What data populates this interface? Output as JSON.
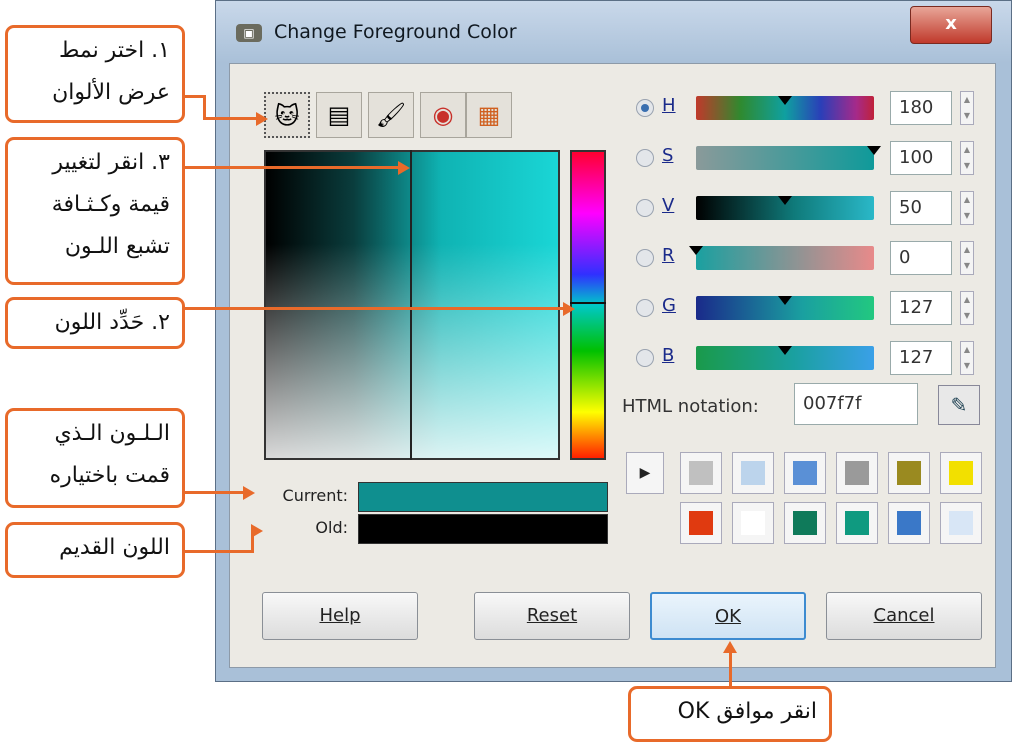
{
  "window": {
    "title": "Change Foreground Color",
    "close_label": "x"
  },
  "tabs": [
    {
      "name": "gimp-selector",
      "icon": "gimp-icon",
      "glyph": "🐱"
    },
    {
      "name": "cmyk-selector",
      "icon": "sliders-icon",
      "glyph": "▤"
    },
    {
      "name": "watercolor-selector",
      "icon": "brush-icon",
      "glyph": "🖌"
    },
    {
      "name": "wheel-selector",
      "icon": "color-wheel-icon",
      "glyph": "◉"
    },
    {
      "name": "palette-selector",
      "icon": "palette-icon",
      "glyph": "▦"
    }
  ],
  "swatches": {
    "current_label": "Current:",
    "old_label": "Old:",
    "current_color": "#0f8f8f",
    "old_color": "#000000"
  },
  "channels": [
    {
      "key": "H",
      "value": "180",
      "selected": true
    },
    {
      "key": "S",
      "value": "100",
      "selected": false
    },
    {
      "key": "V",
      "value": "50",
      "selected": false
    },
    {
      "key": "R",
      "value": "0",
      "selected": false
    },
    {
      "key": "G",
      "value": "127",
      "selected": false
    },
    {
      "key": "B",
      "value": "127",
      "selected": false
    }
  ],
  "html_notation": {
    "label": "HTML notation:",
    "value": "007f7f"
  },
  "history_colors": [
    "#c0c0c0",
    "#bcd4ec",
    "#5a90d6",
    "#9a9a9a",
    "#9a8a20",
    "#f2e000",
    "#e03a10",
    "#ffffff",
    "#0f7a5a",
    "#0f9a80",
    "#3a78c8",
    "#d8e6f6"
  ],
  "buttons": {
    "help": "Help",
    "reset": "Reset",
    "ok": "OK",
    "cancel": "Cancel"
  },
  "callouts": {
    "select_mode": "١. اختر نمط عرض الألوان",
    "adjust_value": "٣. انقر لتغيير قيمة وكـثـافة تشبع اللـون",
    "choose_color": "٢. حَدِّد اللون",
    "selected_color": "الـلـون الـذي قمت باختياره",
    "old_color": "اللون القديم",
    "click_ok": "انقر موافق OK"
  }
}
